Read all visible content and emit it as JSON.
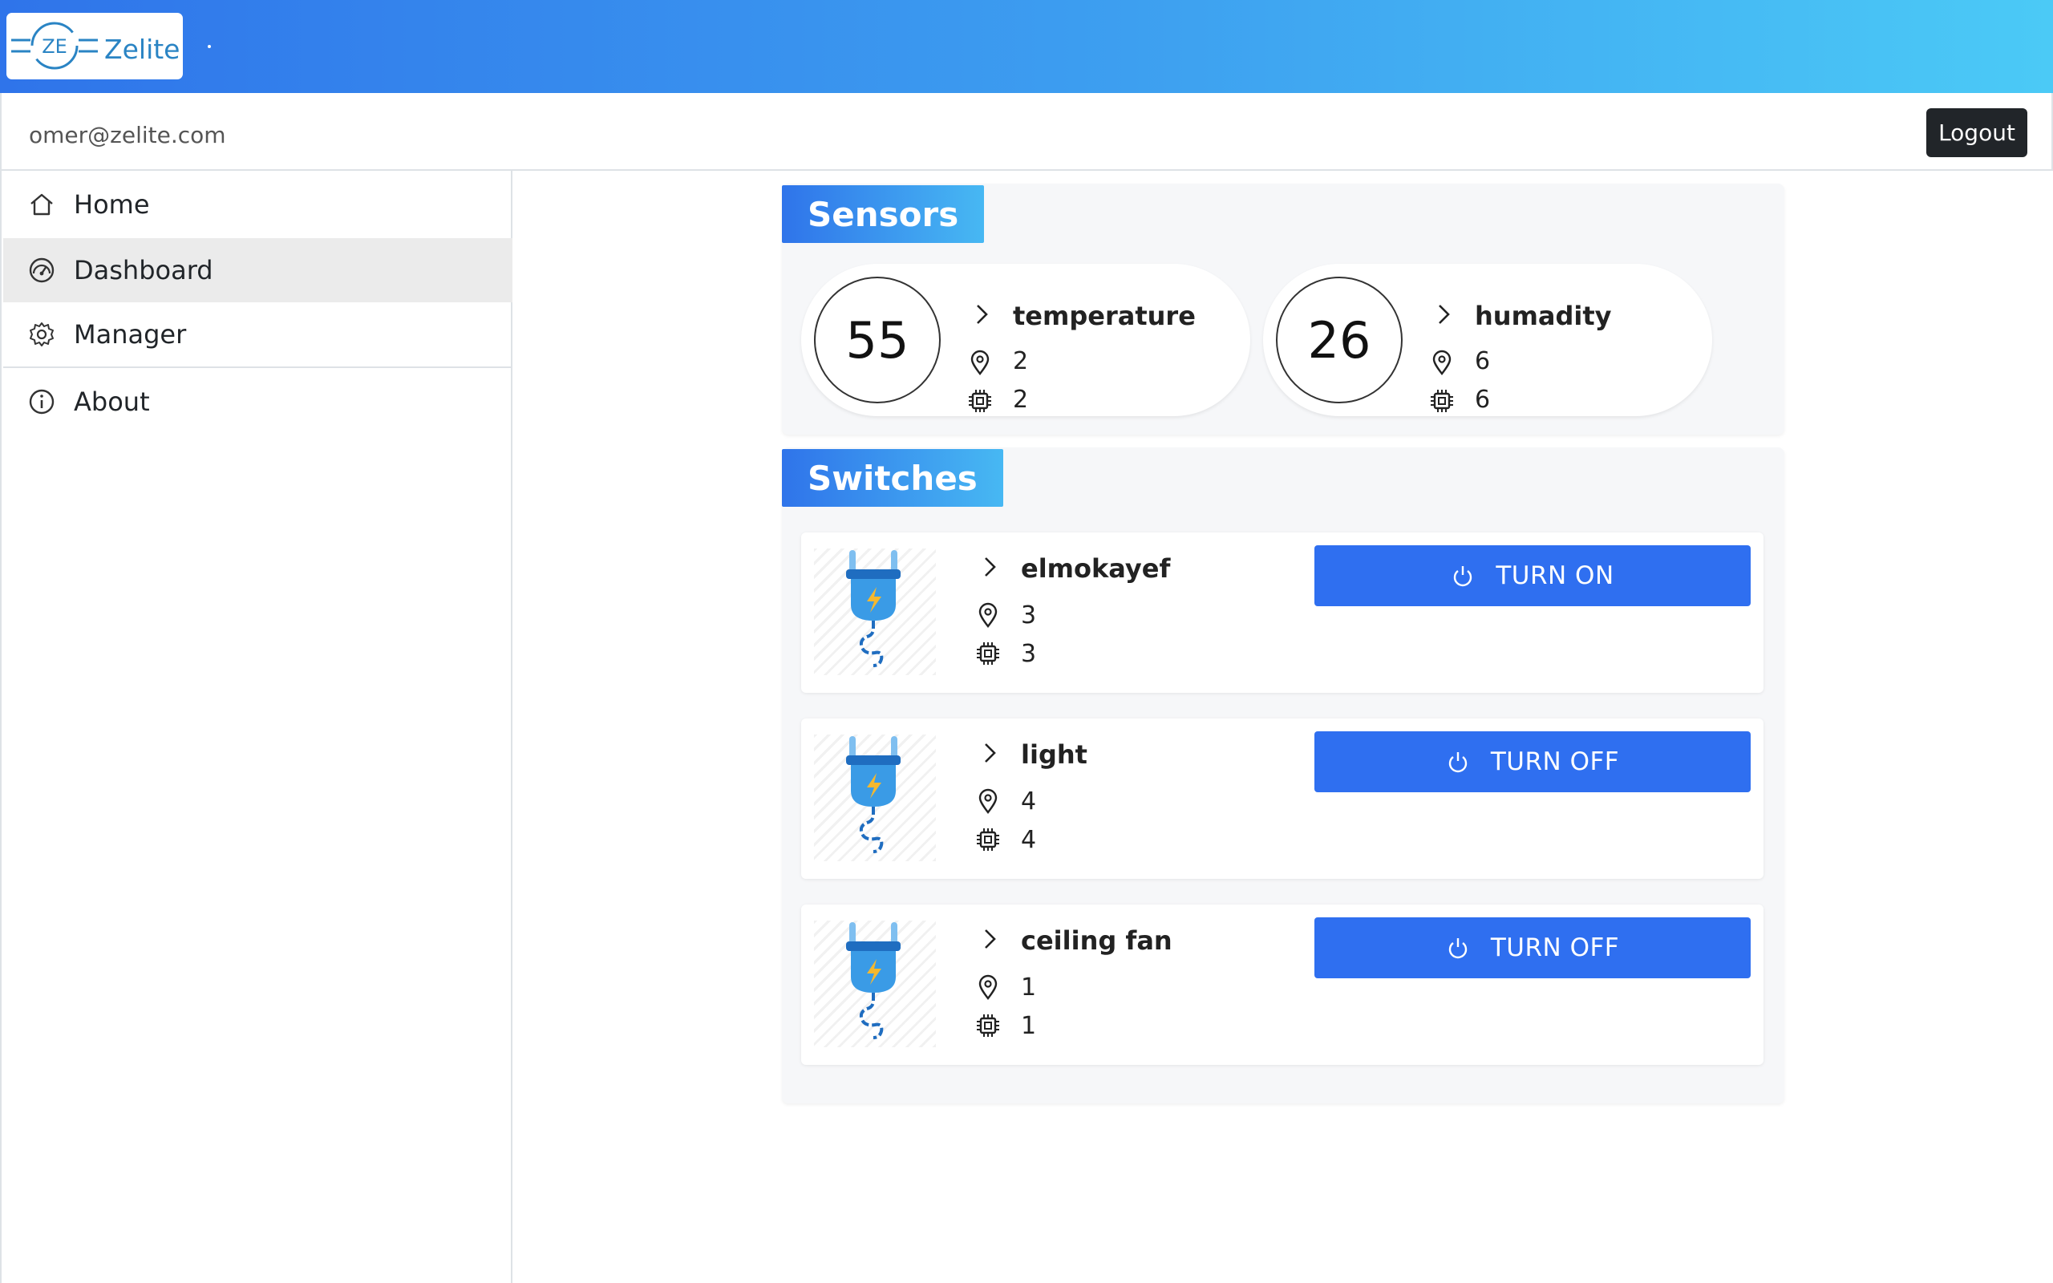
{
  "header": {
    "brand_name": "Zelite",
    "logo_text": "ZE"
  },
  "user": {
    "email": "omer@zelite.com",
    "logout_label": "Logout"
  },
  "sidebar": {
    "items": [
      {
        "label": "Home",
        "icon": "home-icon",
        "active": false
      },
      {
        "label": "Dashboard",
        "icon": "dashboard-icon",
        "active": true
      },
      {
        "label": "Manager",
        "icon": "gear-icon",
        "active": false
      },
      {
        "label": "About",
        "icon": "info-icon",
        "active": false
      }
    ]
  },
  "sensors": {
    "title": "Sensors",
    "items": [
      {
        "name": "temperature",
        "value": "55",
        "location": "2",
        "device": "2"
      },
      {
        "name": "humadity",
        "value": "26",
        "location": "6",
        "device": "6"
      }
    ]
  },
  "switches": {
    "title": "Switches",
    "items": [
      {
        "name": "elmokayef",
        "location": "3",
        "device": "3",
        "button_label": "TURN ON"
      },
      {
        "name": "light",
        "location": "4",
        "device": "4",
        "button_label": "TURN OFF"
      },
      {
        "name": "ceiling fan",
        "location": "1",
        "device": "1",
        "button_label": "TURN OFF"
      }
    ]
  },
  "colors": {
    "accent": "#2f6ff0",
    "header_start": "#2f74ea",
    "header_end": "#4bcaf6",
    "logout_bg": "#212529"
  }
}
